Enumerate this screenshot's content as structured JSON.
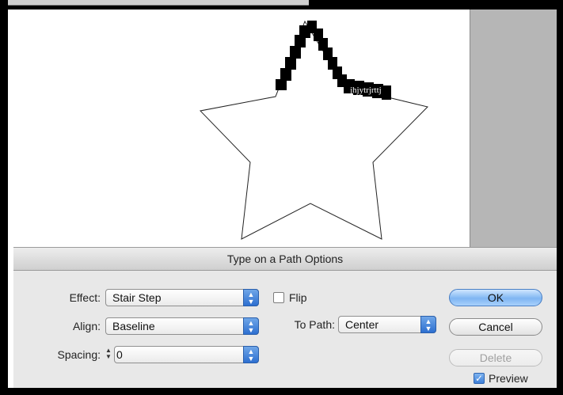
{
  "path_text": "jhjytrjrttj",
  "dialog": {
    "title": "Type on a Path Options",
    "effect_label": "Effect:",
    "effect_value": "Stair Step",
    "align_label": "Align:",
    "align_value": "Baseline",
    "spacing_label": "Spacing:",
    "spacing_value": "0",
    "flip_label": "Flip",
    "flip_checked": false,
    "to_path_label": "To Path:",
    "to_path_value": "Center",
    "ok_label": "OK",
    "cancel_label": "Cancel",
    "delete_label": "Delete",
    "preview_label": "Preview",
    "preview_checked": true
  },
  "colors": {
    "canvas": "#ffffff",
    "pasteboard": "#b6b6b6",
    "accent": "#3d7fd8"
  }
}
